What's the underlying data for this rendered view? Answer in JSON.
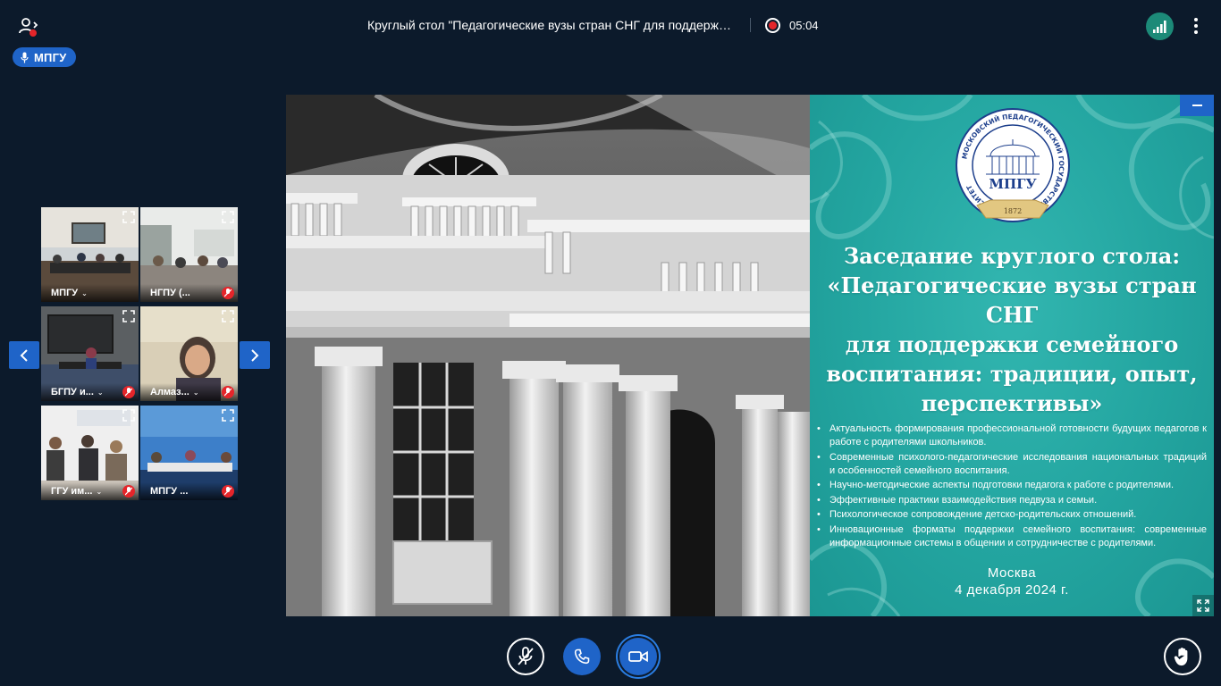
{
  "header": {
    "title": "Круглый стол \"Педагогические вузы стран СНГ для поддержки семейного воспитания: традиции, опыт, перспективы\"",
    "timer": "05:04"
  },
  "speaker": {
    "name": "МПГУ"
  },
  "thumbnails": [
    {
      "name": "МПГУ",
      "muted": false,
      "active": true
    },
    {
      "name": "НГПУ (...",
      "muted": true,
      "active": false
    },
    {
      "name": "БГПУ и...",
      "muted": true,
      "active": false
    },
    {
      "name": "Алмаз...",
      "muted": true,
      "active": false
    },
    {
      "name": "ГГУ им...",
      "muted": true,
      "active": false
    },
    {
      "name": "МПГУ ...",
      "muted": true,
      "active": false
    }
  ],
  "slide": {
    "logo": {
      "ring_text": "МОСКОВСКИЙ ПЕДАГОГИЧЕСКИЙ ГОСУДАРСТВЕННЫЙ УНИВЕРСИТЕТ",
      "abbr": "МПГУ",
      "year": "1872"
    },
    "heading": [
      "Заседание круглого стола:",
      "«Педагогические вузы стран СНГ",
      "для поддержки семейного",
      "воспитания: традиции, опыт,",
      "перспективы»"
    ],
    "topics": [
      "Актуальность формирования профессиональной готовности будущих педагогов к работе с родителями школьников.",
      "Современные психолого-педагогические исследования национальных традиций и особенностей семейного воспитания.",
      "Научно-методические аспекты подготовки педагога к работе с родителями.",
      "Эффективные практики взаимодействия педвуза и семьи.",
      "Психологическое сопровождение детско-родительских отношений.",
      "Инновационные форматы поддержки семейного воспитания: современные информационные системы в общении и сотрудничестве с родителями."
    ],
    "city": "Москва",
    "date": "4 декабря 2024 г."
  },
  "colors": {
    "background": "#0c1a2b",
    "accent": "#1f64c8",
    "slide_teal": "#23a5a0",
    "record_red": "#e5252a",
    "signal_green": "#1c8a78"
  }
}
